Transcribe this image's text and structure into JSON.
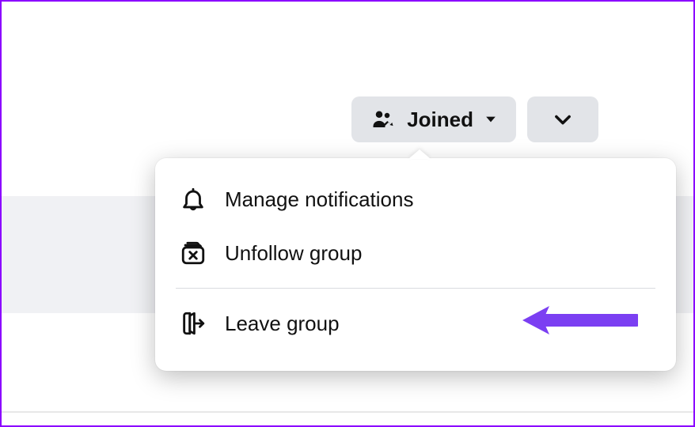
{
  "toolbar": {
    "joined_label": "Joined"
  },
  "menu": {
    "manage_notifications": "Manage notifications",
    "unfollow_group": "Unfollow group",
    "leave_group": "Leave group"
  },
  "annotation": {
    "arrow_color": "#7b3ff2"
  }
}
